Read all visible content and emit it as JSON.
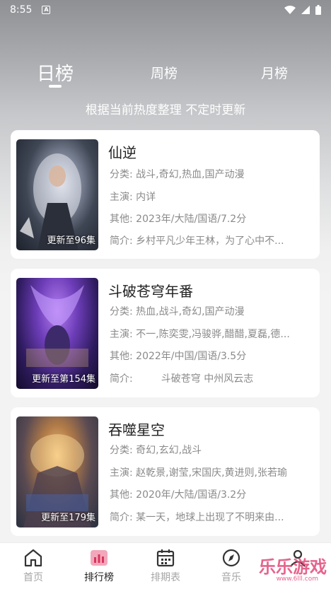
{
  "status_bar": {
    "time": "8:55",
    "notification_glyph": "A"
  },
  "tabs": [
    {
      "label": "日榜",
      "active": true
    },
    {
      "label": "周榜",
      "active": false
    },
    {
      "label": "月榜",
      "active": false
    }
  ],
  "subtitle": "根据当前热度整理 不定时更新",
  "labels": {
    "category": "分类:",
    "cast": "主演:",
    "other": "其他:",
    "summary": "简介:"
  },
  "items": [
    {
      "title": "仙逆",
      "badge": "更新至96集",
      "category": "战斗,奇幻,热血,国产动漫",
      "cast": "内详",
      "other": "2023年/大陆/国语/7.2分",
      "summary": "乡村平凡少年王林，为了心中不..."
    },
    {
      "title": "斗破苍穹年番",
      "badge": "更新至第154集",
      "category": "热血,战斗,奇幻,国产动漫",
      "cast": "不一,陈奕雯,冯骏骅,醋醋,夏磊,德...",
      "other": "2022年/中国/国语/3.5分",
      "summary": "        斗破苍穹 中州风云志"
    },
    {
      "title": "吞噬星空",
      "badge": "更新至179集",
      "category": "奇幻,玄幻,战斗",
      "cast": "赵乾景,谢莹,宋国庆,黄进则,张若瑜",
      "other": "2020年/大陆/国语/3.2分",
      "summary": "某一天，地球上出现了不明来由..."
    }
  ],
  "bottom_nav": [
    {
      "label": "首页",
      "icon": "home-icon",
      "active": false
    },
    {
      "label": "排行榜",
      "icon": "ranking-icon",
      "active": true
    },
    {
      "label": "排期表",
      "icon": "calendar-icon",
      "active": false
    },
    {
      "label": "音乐",
      "icon": "compass-icon",
      "active": false
    },
    {
      "label": "",
      "icon": "user-icon",
      "active": false
    }
  ],
  "watermark": {
    "text": "乐乐游戏",
    "sub": "www.6lll.com"
  },
  "colors": {
    "accent": "#e24a7a",
    "active_nav": "#222222",
    "inactive_nav": "#a6a6a6"
  }
}
